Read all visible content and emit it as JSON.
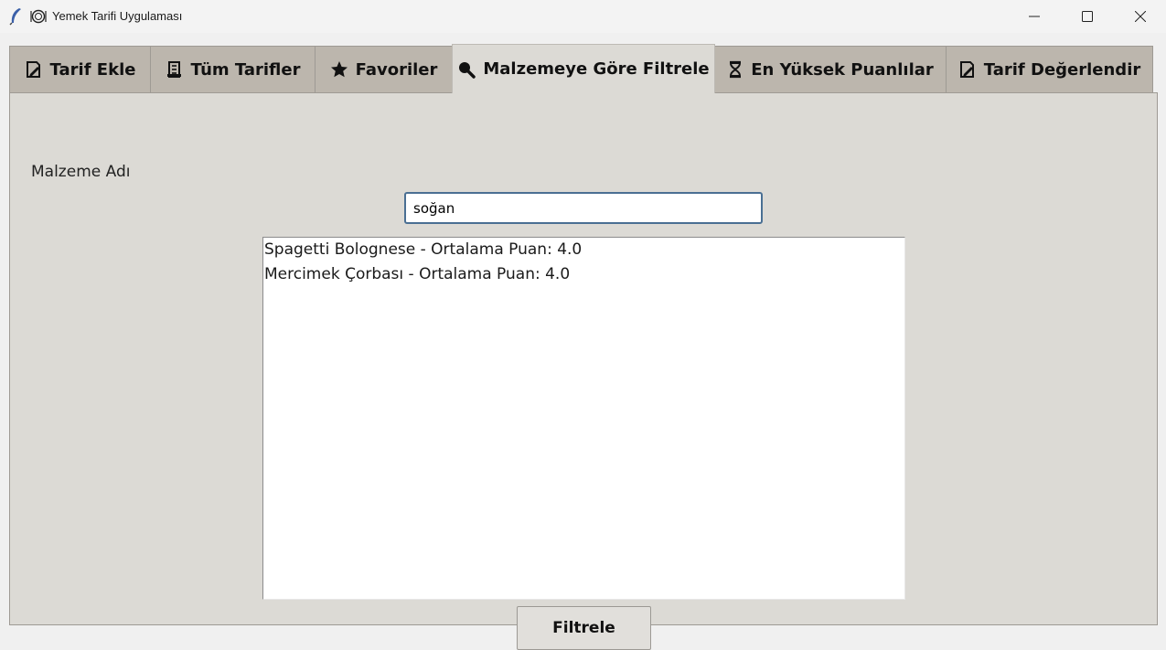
{
  "window": {
    "title": "Yemek Tarifi Uygulaması",
    "controls": [
      "minimize",
      "maximize",
      "close"
    ]
  },
  "tabs": [
    {
      "label": "Tarif Ekle",
      "icon": "memo-pencil-icon",
      "active": false
    },
    {
      "label": "Tüm Tarifler",
      "icon": "scroll-icon",
      "active": false
    },
    {
      "label": "Favoriler",
      "icon": "star-icon",
      "active": false
    },
    {
      "label": "Malzemeye Göre Filtrele",
      "icon": "magnifier-icon",
      "active": true
    },
    {
      "label": "En Yüksek Puanlılar",
      "icon": "hourglass-icon",
      "active": false
    },
    {
      "label": "Tarif Değerlendir",
      "icon": "memo-pencil-icon",
      "active": false
    }
  ],
  "filter_panel": {
    "ingredient_label": "Malzeme Adı",
    "ingredient_value": "soğan",
    "results": [
      "Spagetti Bolognese - Ortalama Puan: 4.0",
      "Mercimek Çorbası - Ortalama Puan: 4.0"
    ],
    "filter_button": "Filtrele"
  },
  "colors": {
    "panel_bg": "#dcdad5",
    "tab_bg": "#bcb6ad",
    "input_focus_border": "#4a6f93"
  }
}
